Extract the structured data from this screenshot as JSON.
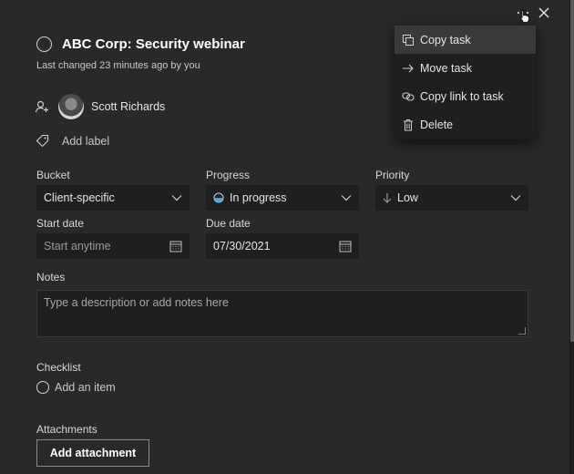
{
  "task": {
    "title": "ABC Corp: Security webinar",
    "last_changed": "Last changed 23 minutes ago by you",
    "assignee": "Scott Richards",
    "add_label": "Add label"
  },
  "fields": {
    "bucket": {
      "label": "Bucket",
      "value": "Client-specific"
    },
    "progress": {
      "label": "Progress",
      "value": "In progress"
    },
    "priority": {
      "label": "Priority",
      "value": "Low"
    },
    "start_date": {
      "label": "Start date",
      "placeholder": "Start anytime"
    },
    "due_date": {
      "label": "Due date",
      "value": "07/30/2021"
    }
  },
  "notes": {
    "label": "Notes",
    "placeholder": "Type a description or add notes here"
  },
  "checklist": {
    "label": "Checklist",
    "add_item": "Add an item"
  },
  "attachments": {
    "label": "Attachments",
    "button": "Add attachment"
  },
  "menu": {
    "items": [
      {
        "label": "Copy task",
        "icon": "copy-icon"
      },
      {
        "label": "Move task",
        "icon": "arrow-right-icon"
      },
      {
        "label": "Copy link to task",
        "icon": "link-icon"
      },
      {
        "label": "Delete",
        "icon": "trash-icon"
      }
    ]
  }
}
